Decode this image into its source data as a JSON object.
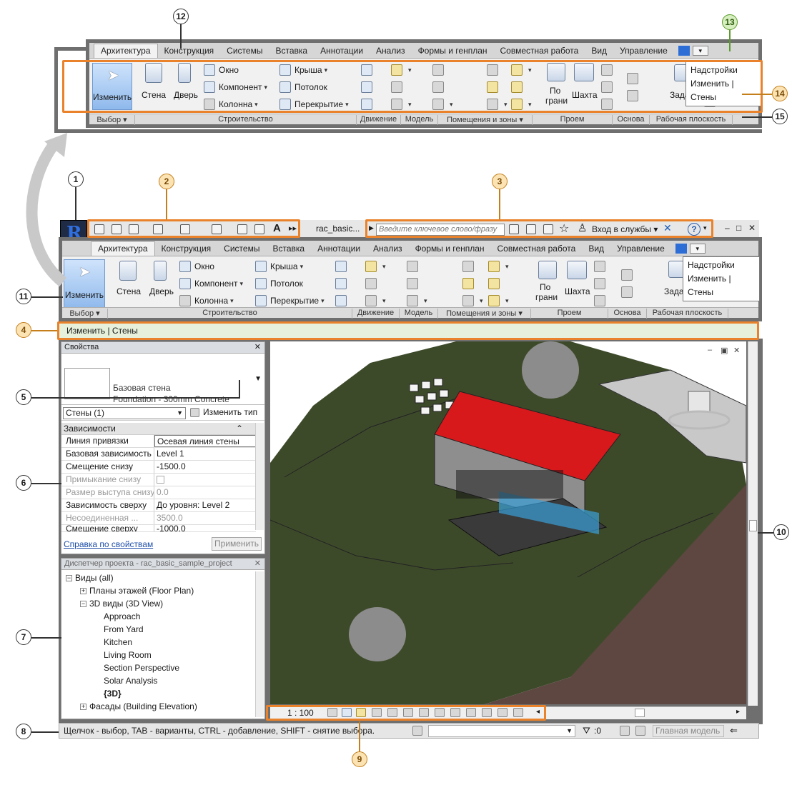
{
  "callouts": [
    "1",
    "2",
    "3",
    "4",
    "5",
    "6",
    "7",
    "8",
    "9",
    "10",
    "11",
    "12",
    "13",
    "14",
    "15"
  ],
  "ribbon": {
    "tabs": [
      "Архитектура",
      "Конструкция",
      "Системы",
      "Вставка",
      "Аннотации",
      "Анализ",
      "Формы и генплан",
      "Совместная работа",
      "Вид",
      "Управление"
    ],
    "modify_label": "Изменить",
    "select_panel": "Выбор",
    "build": {
      "wall": "Стена",
      "door": "Дверь",
      "window": "Окно",
      "component": "Компонент",
      "column": "Колонна",
      "roof": "Крыша",
      "ceiling": "Потолок",
      "floor": "Перекрытие"
    },
    "opening": {
      "by_face_1": "По",
      "by_face_2": "грани",
      "shaft": "Шахта"
    },
    "set_label": "Задать",
    "panel_titles": {
      "build": "Строительство",
      "circulation": "Движение",
      "model": "Модель",
      "rooms": "Помещения и зоны",
      "opening": "Проем",
      "datum": "Основа",
      "workplane": "Рабочая плоскость"
    },
    "context_popup": [
      "Надстройки",
      "Изменить | Стены"
    ]
  },
  "title_bar": {
    "file_name": "rac_basic...",
    "search_placeholder": "Введите ключевое слово/фразу",
    "sign_in": "Вход в службы",
    "help": "?"
  },
  "options_bar": {
    "text": "Изменить | Стены"
  },
  "properties": {
    "title": "Свойства",
    "type_line1": "Базовая стена",
    "type_line2": "Foundation - 300mm Concrete",
    "filter": "Стены (1)",
    "edit_type": "Изменить тип",
    "group": "Зависимости",
    "rows": [
      {
        "k": "Линия привязки",
        "v": "Осевая линия стены"
      },
      {
        "k": "Базовая зависимость",
        "v": "Level 1"
      },
      {
        "k": "Смещение снизу",
        "v": "-1500.0"
      },
      {
        "k": "Примыкание снизу",
        "v": ""
      },
      {
        "k": "Размер выступа снизу",
        "v": "0.0"
      },
      {
        "k": "Зависимость сверху",
        "v": "До уровня: Level 2"
      },
      {
        "k": "Несоединенная ...",
        "v": "3500.0"
      },
      {
        "k": "Смещение сверху",
        "v": "-1000.0"
      }
    ],
    "help_link": "Справка по свойствам",
    "apply": "Применить"
  },
  "browser": {
    "title": "Диспетчер проекта - rac_basic_sample_project",
    "items": [
      {
        "label": "Виды (all)",
        "level": 0,
        "exp": "−"
      },
      {
        "label": "Планы этажей (Floor Plan)",
        "level": 1,
        "exp": "+"
      },
      {
        "label": "3D виды (3D View)",
        "level": 1,
        "exp": "−"
      },
      {
        "label": "Approach",
        "level": 2,
        "exp": ""
      },
      {
        "label": "From Yard",
        "level": 2,
        "exp": ""
      },
      {
        "label": "Kitchen",
        "level": 2,
        "exp": ""
      },
      {
        "label": "Living Room",
        "level": 2,
        "exp": ""
      },
      {
        "label": "Section Perspective",
        "level": 2,
        "exp": ""
      },
      {
        "label": "Solar Analysis",
        "level": 2,
        "exp": ""
      },
      {
        "label": "{3D}",
        "level": 2,
        "exp": ""
      },
      {
        "label": "Фасады (Building Elevation)",
        "level": 1,
        "exp": "+"
      }
    ]
  },
  "view_control": {
    "scale": "1 : 100"
  },
  "status_bar": {
    "hint": "Щелчок - выбор, TAB - варианты, CTRL - добавление, SHIFT - снятие выбора.",
    "count": ":0",
    "model": "Главная модель"
  },
  "colors": {
    "ribbon_border": "#6f6f6f",
    "highlight": "#e9822a",
    "roof": "#d7191c",
    "terrain": "#3d4a2a",
    "soil": "#6b5148"
  }
}
